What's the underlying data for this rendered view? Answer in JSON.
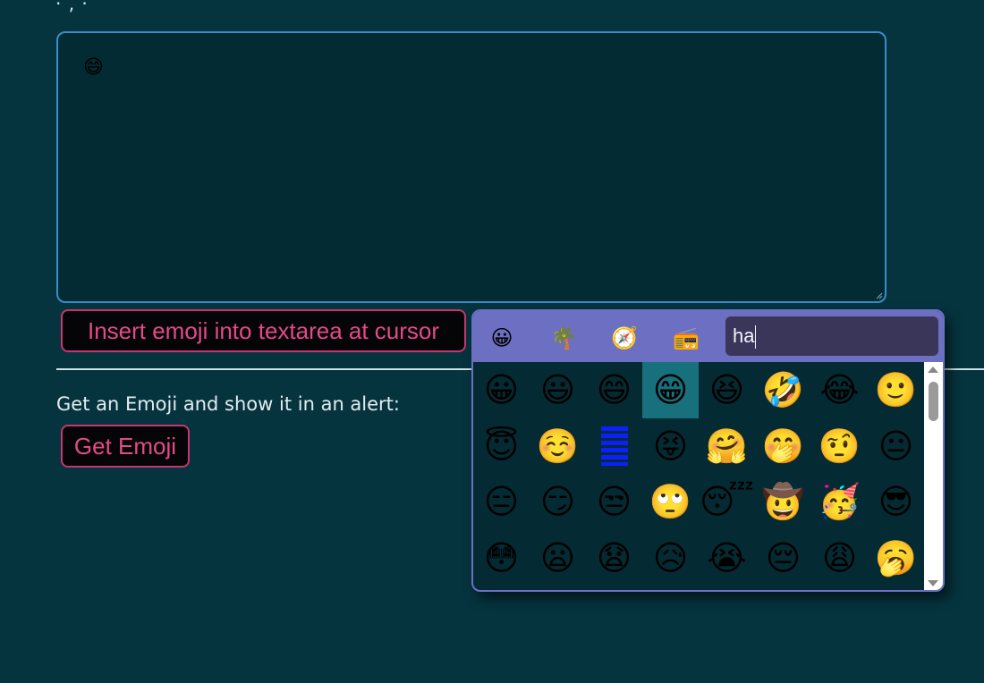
{
  "textarea": {
    "content": "😄"
  },
  "buttons": {
    "insert_label": "Insert emoji into textarea at cursor",
    "get_label": "Get Emoji"
  },
  "alert_section": {
    "label": "Get an Emoji and show it in an alert:"
  },
  "picker": {
    "categories": [
      {
        "name": "smileys",
        "icon": "😀"
      },
      {
        "name": "nature",
        "icon": "🌴"
      },
      {
        "name": "travel",
        "icon": "🧭"
      },
      {
        "name": "objects",
        "icon": "📻"
      }
    ],
    "search_value": "ha",
    "selected_index": 3,
    "emojis": [
      "😀",
      "😃",
      "😄",
      "😁",
      "😆",
      "🤣",
      "😂",
      "🙂",
      "😇",
      "☺️",
      "",
      "😝",
      "🤗",
      "🤭",
      "🤨",
      "😐",
      "😑",
      "😏",
      "😒",
      "🙄",
      "😴",
      "🤠",
      "🥳",
      "😎",
      "😳",
      "😦",
      "😧",
      "😥",
      "😭",
      "😔",
      "😩",
      "🥱"
    ]
  },
  "colors": {
    "background": "#05343f",
    "accent_pink": "#e24b86",
    "picker_header": "#6d70c2",
    "selected_cell": "#18707d"
  }
}
